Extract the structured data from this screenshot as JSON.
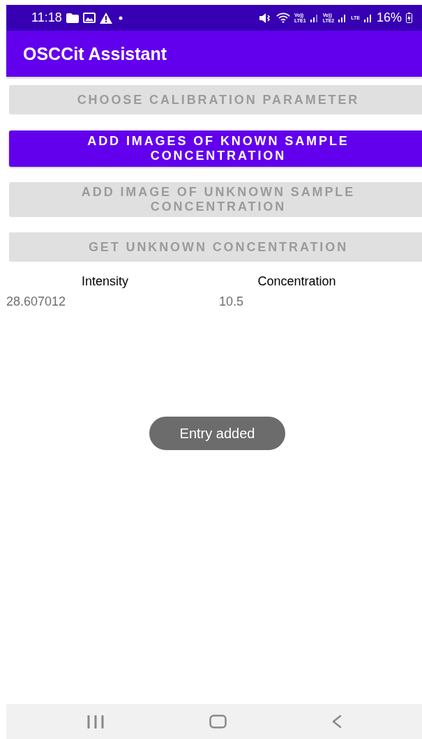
{
  "status_bar": {
    "time": "11:18",
    "network_labels": [
      {
        "top": "Vo))",
        "bottom": "LTE1"
      },
      {
        "top": "Vo))",
        "bottom": "LTE2"
      },
      {
        "top": "LTE"
      }
    ],
    "battery": "16%"
  },
  "app_bar": {
    "title": "OSCCit Assistant"
  },
  "buttons": [
    {
      "label": "CHOOSE CALIBRATION PARAMETER",
      "disabled": true
    },
    {
      "label": "ADD IMAGES OF KNOWN SAMPLE CONCENTRATION",
      "disabled": false
    },
    {
      "label": "ADD IMAGE OF UNKNOWN SAMPLE CONCENTRATION",
      "disabled": true
    },
    {
      "label": "GET UNKNOWN CONCENTRATION",
      "disabled": true
    }
  ],
  "table": {
    "columns": [
      "Intensity",
      "Concentration"
    ],
    "rows": [
      [
        "28.607012",
        "10.5"
      ]
    ]
  },
  "toast": {
    "text": "Entry added"
  }
}
